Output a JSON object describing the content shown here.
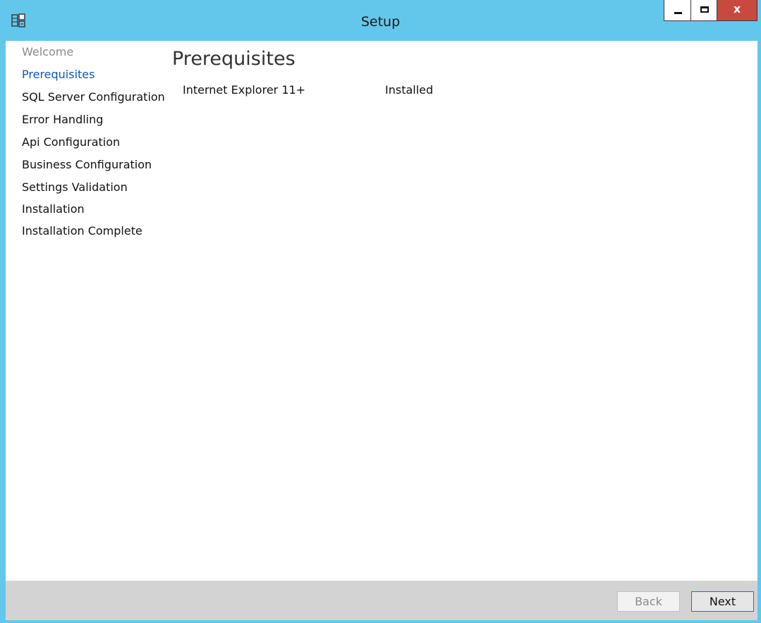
{
  "window": {
    "title": "Setup",
    "app_icon": "setup-installer-icon",
    "controls": {
      "minimize": "minimize-icon",
      "maximize": "maximize-icon",
      "close": "close-icon",
      "close_label": "x"
    }
  },
  "sidebar": {
    "items": [
      {
        "label": "Welcome",
        "state": "done"
      },
      {
        "label": "Prerequisites",
        "state": "active"
      },
      {
        "label": "SQL Server Configuration",
        "state": "pending"
      },
      {
        "label": "Error Handling",
        "state": "pending"
      },
      {
        "label": "Api Configuration",
        "state": "pending"
      },
      {
        "label": "Business Configuration",
        "state": "pending"
      },
      {
        "label": "Settings Validation",
        "state": "pending"
      },
      {
        "label": "Installation",
        "state": "pending"
      },
      {
        "label": "Installation Complete",
        "state": "pending"
      }
    ]
  },
  "main": {
    "heading": "Prerequisites",
    "prerequisites": [
      {
        "name": "Internet Explorer 11+",
        "status": "Installed"
      }
    ]
  },
  "footer": {
    "back_label": "Back",
    "back_enabled": false,
    "next_label": "Next",
    "next_enabled": true
  },
  "colors": {
    "titlebar": "#63c7ec",
    "active_nav": "#0e58b0",
    "done_nav": "#8a8a8a",
    "close_button": "#c7493f",
    "footer": "#d3d3d3"
  }
}
